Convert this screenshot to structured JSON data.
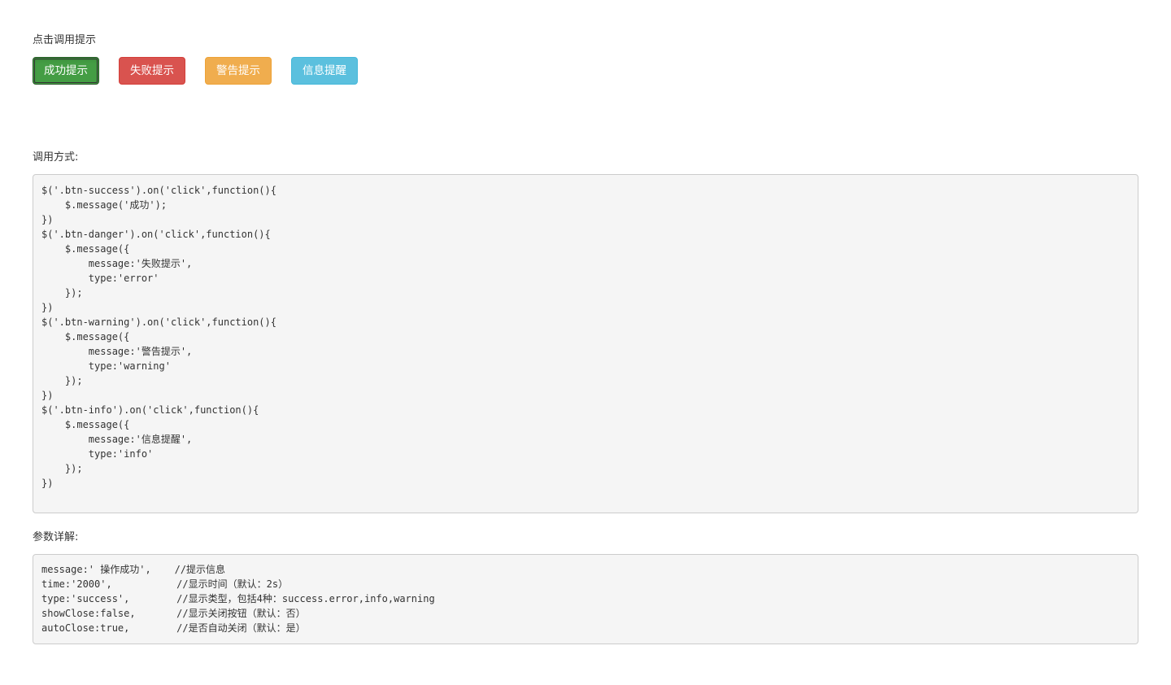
{
  "trigger": {
    "label": "点击调用提示",
    "buttons": {
      "success": "成功提示",
      "danger": "失败提示",
      "warning": "警告提示",
      "info": "信息提醒"
    }
  },
  "usage": {
    "label": "调用方式:",
    "code": "$('.btn-success').on('click',function(){\n    $.message('成功');\n})\n$('.btn-danger').on('click',function(){\n    $.message({\n        message:'失败提示',\n        type:'error'\n    });\n})\n$('.btn-warning').on('click',function(){\n    $.message({\n        message:'警告提示',\n        type:'warning'\n    });\n})\n$('.btn-info').on('click',function(){\n    $.message({\n        message:'信息提醒',\n        type:'info'\n    });\n})"
  },
  "params": {
    "label": "参数详解:",
    "code": "message:' 操作成功',    //提示信息\ntime:'2000',           //显示时间（默认：2s）\ntype:'success',        //显示类型，包括4种：success.error,info,warning\nshowClose:false,       //显示关闭按钮（默认：否）\nautoClose:true,        //是否自动关闭（默认：是）"
  },
  "colors": {
    "success": "#449d44",
    "danger": "#d9534f",
    "warning": "#f0ad4e",
    "info": "#5bc0de",
    "code_bg": "#f5f5f5"
  }
}
